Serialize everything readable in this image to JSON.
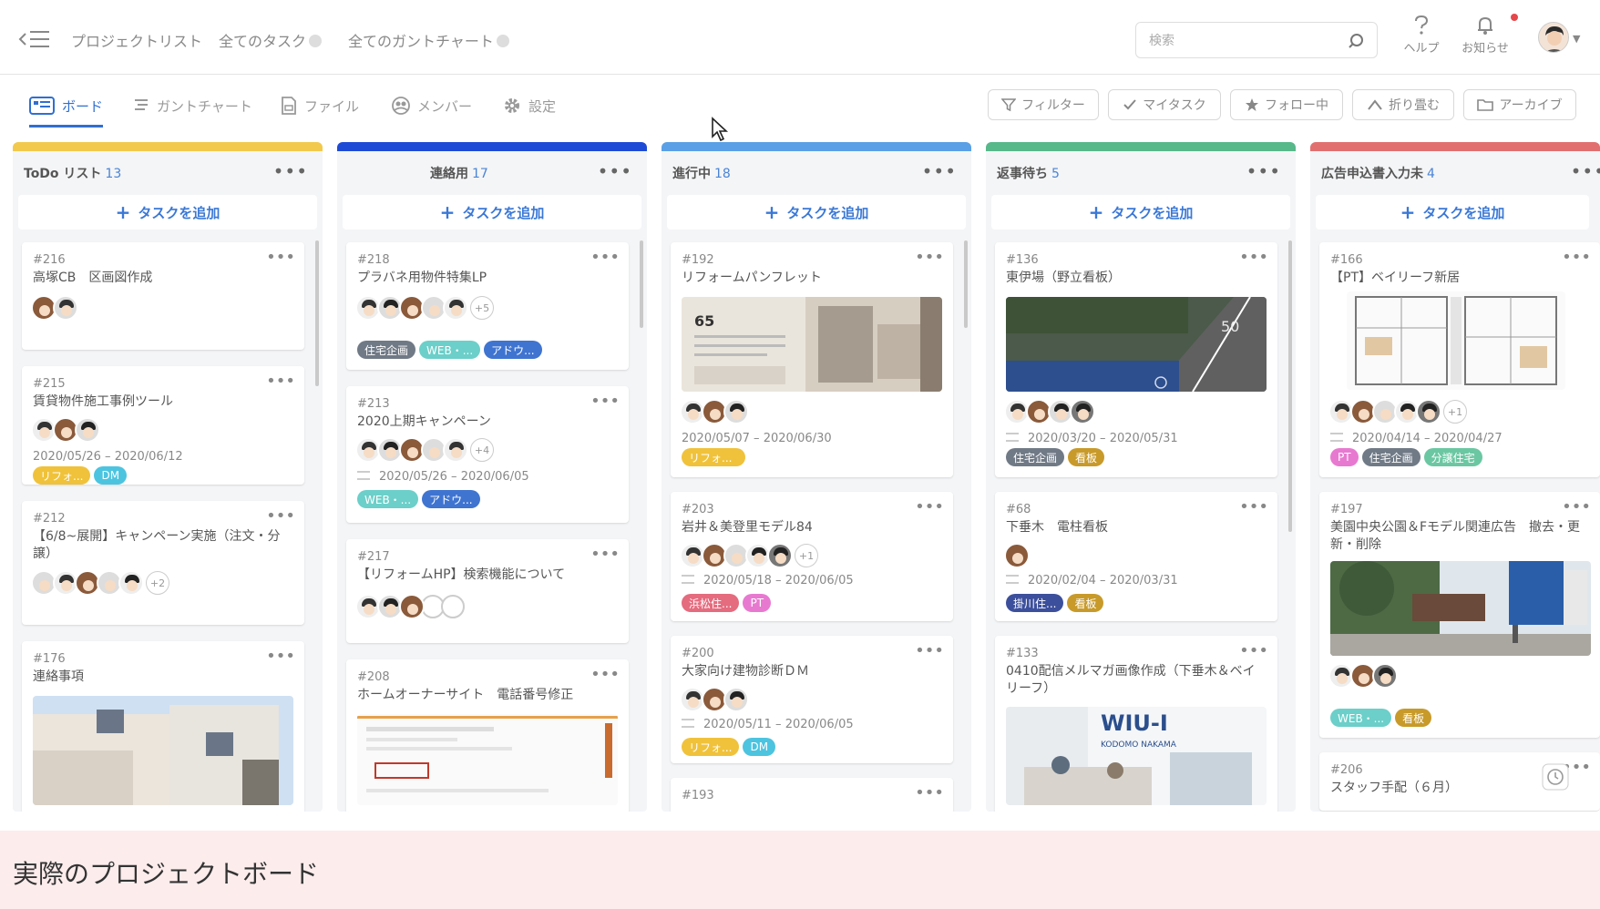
{
  "nav": {
    "links": [
      "プロジェクトリスト",
      "全てのタスク",
      "全てのガントチャート"
    ],
    "search_placeholder": "検索",
    "help_label": "ヘルプ",
    "notify_label": "お知らせ"
  },
  "tabs": [
    "ボード",
    "ガントチャート",
    "ファイル",
    "メンバー",
    "設定"
  ],
  "filters": [
    "フィルター",
    "マイタスク",
    "フォロー中",
    "折り畳む",
    "アーカイブ"
  ],
  "add_task_label": "タスクを追加",
  "colors": {
    "accent": "#2f6fd1",
    "stripe_todo": "#f2c94c",
    "stripe_contact": "#1e4bd6",
    "stripe_progress": "#5aa0e6",
    "stripe_waiting": "#57b88a",
    "stripe_ad": "#e26f6f",
    "tag_gray": "#707a86",
    "tag_teal": "#6ccfc9",
    "tag_blue": "#3f74d0",
    "tag_yellow": "#f0c23b",
    "tag_cyan": "#4cc4e0",
    "tag_pink": "#e56b7e",
    "tag_navy": "#3c4f9c",
    "tag_olive": "#c89a2a",
    "tag_green": "#6bc7a2"
  },
  "columns": [
    {
      "title": "ToDo リスト",
      "count": "13",
      "cards": [
        {
          "id": "#216",
          "title": "高塚CB　区画図作成"
        },
        {
          "id": "#215",
          "title": "賃貸物件施工事例ツール",
          "date": "2020/05/26 – 2020/06/12",
          "tags": [
            "リフォ...",
            "DM"
          ]
        },
        {
          "id": "#212",
          "title": "【6/8~展開】キャンペーン実施（注文・分譲）",
          "more": "+2"
        },
        {
          "id": "#176",
          "title": "連絡事項"
        }
      ]
    },
    {
      "title": "連絡用",
      "count": "17",
      "cards": [
        {
          "id": "#218",
          "title": "プラバネ用物件特集LP",
          "more": "+5",
          "tags": [
            "住宅企画",
            "WEB・...",
            "アドウ..."
          ]
        },
        {
          "id": "#213",
          "title": "2020上期キャンペーン",
          "more": "+4",
          "date": "2020/05/26 – 2020/06/05",
          "tags": [
            "WEB・...",
            "アドウ..."
          ]
        },
        {
          "id": "#217",
          "title": "【リフォームHP】検索機能について"
        },
        {
          "id": "#208",
          "title": "ホームオーナーサイト　電話番号修正"
        }
      ]
    },
    {
      "title": "進行中",
      "count": "18",
      "cards": [
        {
          "id": "#192",
          "title": "リフォームパンフレット",
          "date": "2020/05/07 – 2020/06/30",
          "tags": [
            "リフォ..."
          ],
          "thumb_text": "65"
        },
        {
          "id": "#203",
          "title": "岩井＆美登里モデル84",
          "more": "+1",
          "date": "2020/05/18 – 2020/06/05",
          "tags": [
            "浜松住...",
            "PT"
          ]
        },
        {
          "id": "#200",
          "title": "大家向け建物診断ＤＭ",
          "date": "2020/05/11 – 2020/06/05",
          "tags": [
            "リフォ...",
            "DM"
          ]
        },
        {
          "id": "#193"
        }
      ]
    },
    {
      "title": "返事待ち",
      "count": "5",
      "cards": [
        {
          "id": "#136",
          "title": "東伊場（野立看板）",
          "date": "2020/03/20 – 2020/05/31",
          "tags": [
            "住宅企画",
            "看板"
          ],
          "thumb_text": "50"
        },
        {
          "id": "#68",
          "title": "下垂木　電柱看板",
          "date": "2020/02/04 – 2020/03/31",
          "tags": [
            "掛川住...",
            "看板"
          ]
        },
        {
          "id": "#133",
          "title": "0410配信メルマガ画像作成（下垂木＆ベイリーフ）",
          "thumb_logo": "WIU-I",
          "thumb_sub": "KODOMO NAKAMA"
        }
      ]
    },
    {
      "title": "広告申込書入力未",
      "count": "4",
      "cards": [
        {
          "id": "#166",
          "title": "【PT】ベイリーフ新居",
          "more": "+1",
          "date": "2020/04/14 – 2020/04/27",
          "tags": [
            "PT",
            "住宅企画",
            "分譲住宅"
          ]
        },
        {
          "id": "#197",
          "title": "美園中央公園＆Fモデル関連広告　撤去・更新・削除",
          "tags": [
            "WEB・...",
            "看板"
          ]
        },
        {
          "id": "#206",
          "title": "スタッフ手配（６月）"
        }
      ]
    }
  ],
  "caption": "実際のプロジェクトボード"
}
